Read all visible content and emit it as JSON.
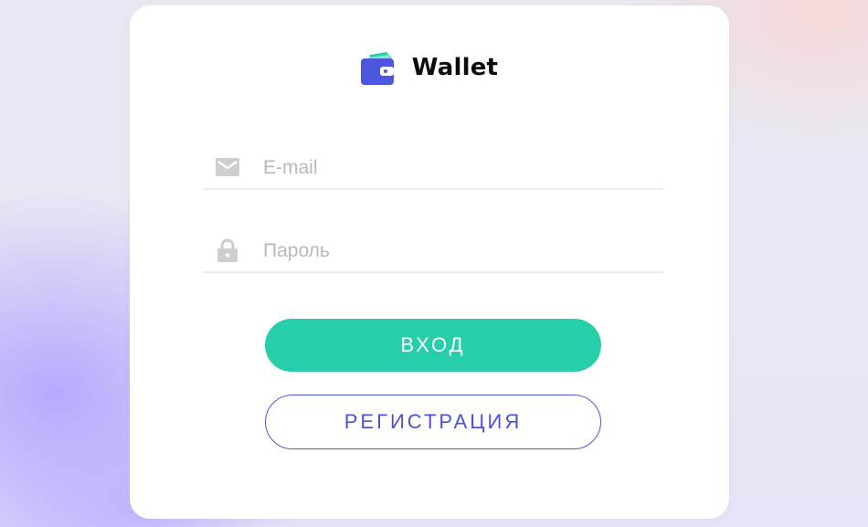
{
  "brand": {
    "name": "Wallet",
    "logo_icon": "wallet-icon",
    "logo_colors": [
      "#4e56e0",
      "#26cfa9"
    ]
  },
  "form": {
    "email": {
      "icon": "envelope-icon",
      "placeholder": "E-mail",
      "value": ""
    },
    "password": {
      "icon": "lock-icon",
      "placeholder": "Пароль",
      "value": ""
    }
  },
  "buttons": {
    "login_label": "ВХОД",
    "register_label": "РЕГИСТРАЦИЯ"
  },
  "colors": {
    "accent_primary": "#26cfa9",
    "accent_secondary": "#4f57d9",
    "icon_muted": "#cdcdd2"
  }
}
